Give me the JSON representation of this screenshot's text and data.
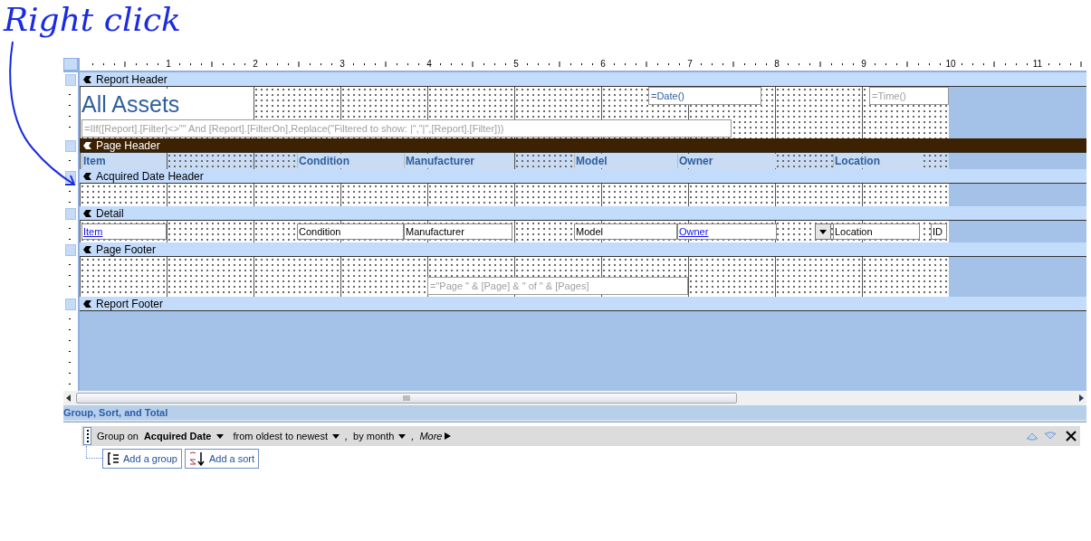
{
  "annotation": {
    "text": "Right click"
  },
  "ruler": {
    "marks": [
      "1",
      "2",
      "3",
      "4",
      "5",
      "6",
      "7",
      "8",
      "9",
      "10",
      "11"
    ]
  },
  "sections": [
    {
      "title": "Report Header",
      "selected": false,
      "controls": [
        {
          "kind": "title",
          "text": "All Assets"
        },
        {
          "kind": "expression",
          "text": "=Date()"
        },
        {
          "kind": "faint",
          "text": "=Time()"
        },
        {
          "kind": "faint",
          "text": "=IIf([Report].[Filter]<>\"\" And [Report].[FilterOn],Replace(\"Filtered to show: |\",\"|\",[Report].[Filter]))"
        }
      ]
    },
    {
      "title": "Page Header",
      "selected": true,
      "controls": [
        {
          "kind": "heading",
          "text": "Item"
        },
        {
          "kind": "heading",
          "text": "Condition"
        },
        {
          "kind": "heading",
          "text": "Manufacturer"
        },
        {
          "kind": "heading",
          "text": "Model"
        },
        {
          "kind": "heading",
          "text": "Owner"
        },
        {
          "kind": "heading",
          "text": "Location"
        }
      ]
    },
    {
      "title": "Acquired Date Header",
      "selected": false
    },
    {
      "title": "Detail",
      "selected": false,
      "controls": [
        {
          "kind": "link",
          "text": "Item"
        },
        {
          "kind": "field",
          "text": "Condition"
        },
        {
          "kind": "field",
          "text": "Manufacturer"
        },
        {
          "kind": "field",
          "text": "Model"
        },
        {
          "kind": "link",
          "text": "Owner"
        },
        {
          "kind": "combo"
        },
        {
          "kind": "field",
          "text": "Location"
        },
        {
          "kind": "field",
          "text": "ID"
        }
      ]
    },
    {
      "title": "Page Footer",
      "selected": false,
      "controls": [
        {
          "kind": "faint",
          "text": "=\"Page \" & [Page] & \" of \" & [Pages]"
        }
      ]
    },
    {
      "title": "Report Footer",
      "selected": false
    }
  ],
  "pane": {
    "title": "Group, Sort, and Total",
    "group": {
      "prefix": "Group on",
      "field": "Acquired Date",
      "options": [
        {
          "text": "from oldest to newest",
          "separator": ","
        },
        {
          "text": "by month",
          "separator": ","
        }
      ],
      "more": "More"
    },
    "buttons": [
      {
        "kind": "group",
        "label": "Add a group"
      },
      {
        "kind": "sort",
        "label": "Add a sort"
      }
    ]
  }
}
